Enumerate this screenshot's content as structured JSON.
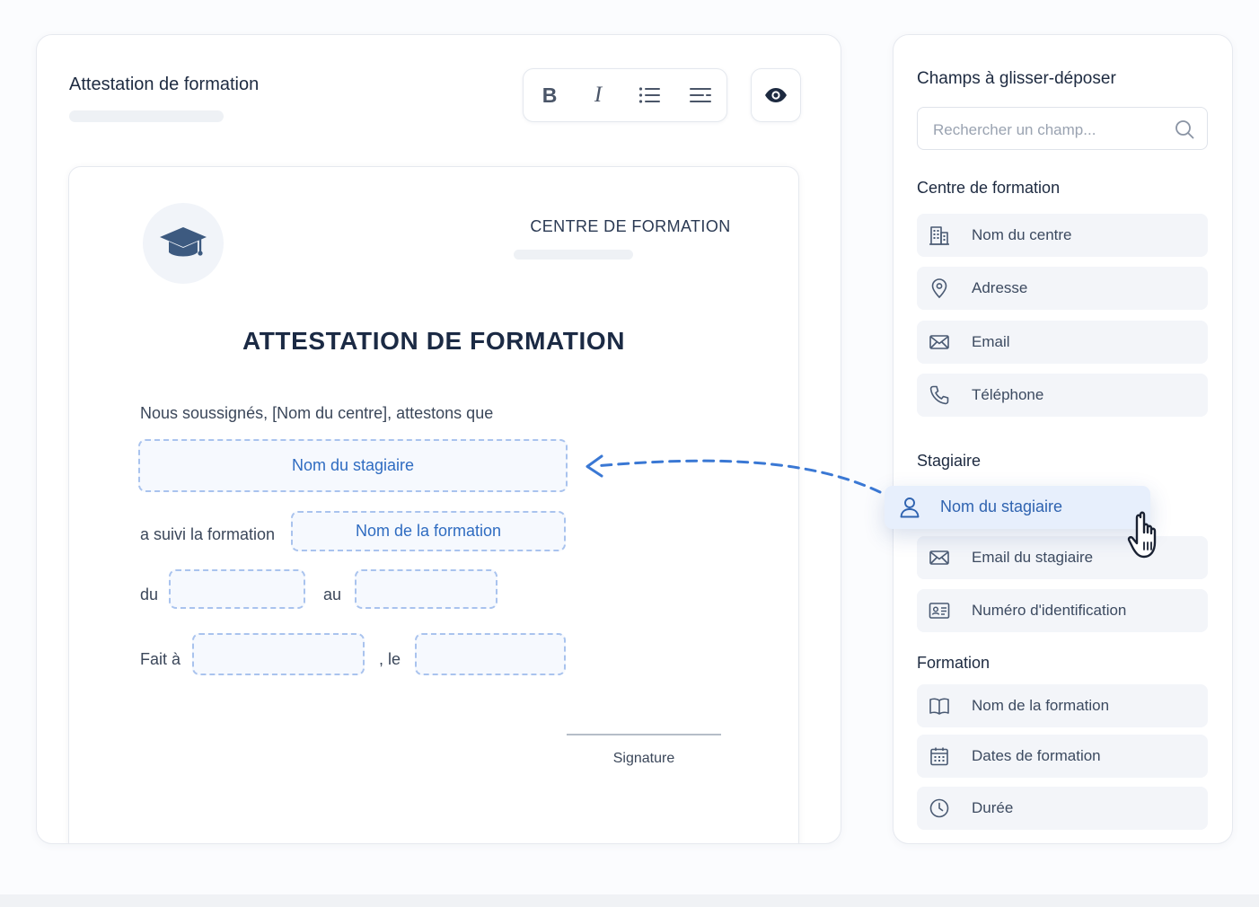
{
  "colors": {
    "accent": "#2f6cc1",
    "text_dark": "#1d2a40",
    "slot_border": "#a9c3ee",
    "item_bg": "#f3f5f9"
  },
  "editor": {
    "title": "Attestation de formation",
    "toolbar": [
      {
        "icon": "bold-icon",
        "label": "B"
      },
      {
        "icon": "italic-icon",
        "label": "I"
      },
      {
        "icon": "bulleted-list-icon"
      },
      {
        "icon": "align-icon"
      }
    ],
    "preview_icon": "eye-icon"
  },
  "document": {
    "logo_icon": "graduation-cap-icon",
    "centre_title": "CENTRE DE FORMATION",
    "heading": "ATTESTATION DE FORMATION",
    "intro": "Nous soussignés, [Nom du centre], attestons que",
    "slot_stagiaire": "Nom du stagiaire",
    "followed_label": "a suivi la formation",
    "slot_formation": "Nom de la formation",
    "du_label": "du",
    "au_label": "au",
    "fait_label": "Fait à",
    "le_label": ", le",
    "signature_label": "Signature"
  },
  "fields_panel": {
    "title": "Champs à glisser-déposer",
    "search_placeholder": "Rechercher un champ...",
    "sections": [
      {
        "title": "Centre de formation",
        "items": [
          {
            "label": "Nom du centre",
            "icon": "building-icon"
          },
          {
            "label": "Adresse",
            "icon": "location-pin-icon"
          },
          {
            "label": "Email",
            "icon": "envelope-icon"
          },
          {
            "label": "Téléphone",
            "icon": "phone-icon"
          }
        ]
      },
      {
        "title": "Stagiaire",
        "items": [
          {
            "label": "Nom du stagiaire",
            "icon": "user-icon",
            "state": "dragging"
          },
          {
            "label": "Email du stagiaire",
            "icon": "envelope-icon"
          },
          {
            "label": "Numéro d'identification",
            "icon": "id-card-icon"
          }
        ]
      },
      {
        "title": "Formation",
        "items": [
          {
            "label": "Nom de la formation",
            "icon": "book-icon"
          },
          {
            "label": "Dates de formation",
            "icon": "calendar-icon"
          },
          {
            "label": "Durée",
            "icon": "clock-icon"
          }
        ]
      }
    ]
  },
  "cursor_icon": "hand-pointer-icon"
}
